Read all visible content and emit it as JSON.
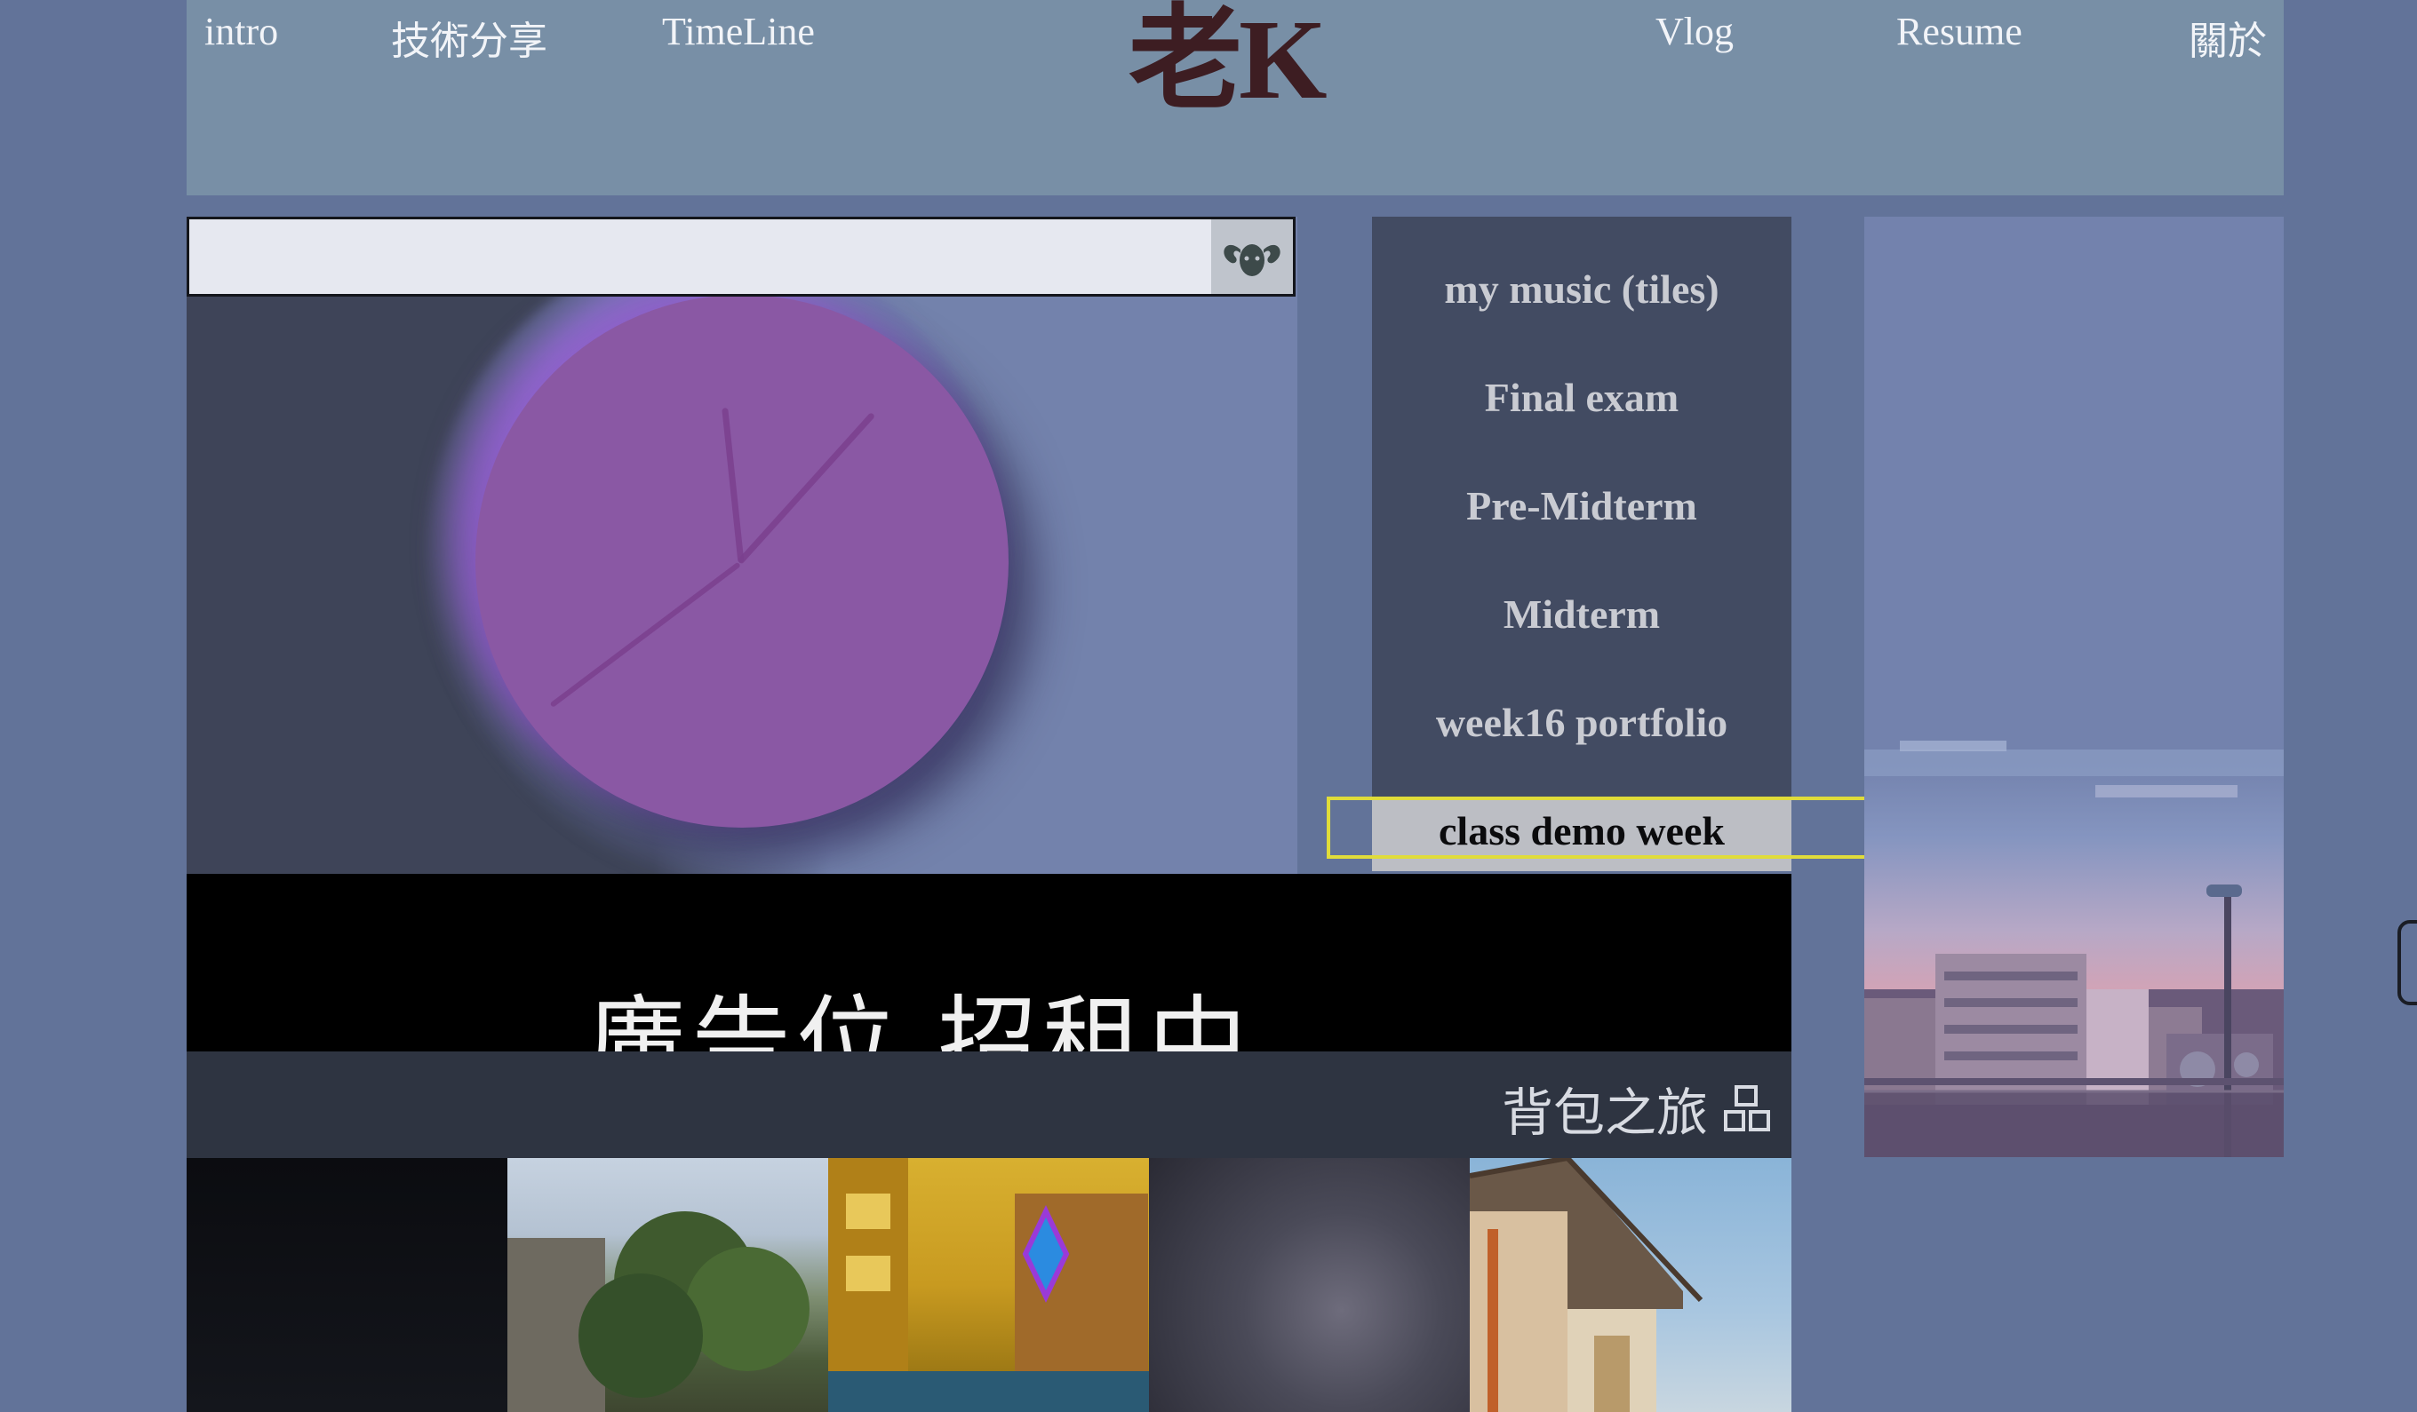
{
  "header": {
    "logo": "老K",
    "nav": [
      {
        "label": "intro"
      },
      {
        "label": "技術分享"
      },
      {
        "label": "TimeLine"
      },
      {
        "label": "Vlog"
      },
      {
        "label": "Resume"
      },
      {
        "label": "關於"
      }
    ]
  },
  "search": {
    "placeholder": "",
    "icon": "ram-icon"
  },
  "menu": {
    "items": [
      {
        "label": "my music (tiles)"
      },
      {
        "label": "Final exam"
      },
      {
        "label": "Pre-Midterm"
      },
      {
        "label": "Midterm"
      },
      {
        "label": "week16 portfolio"
      },
      {
        "label": "class demo week"
      }
    ],
    "active_index": 5
  },
  "ad": {
    "text": "廣告位 招租中"
  },
  "backpack": {
    "title": "背包之旅",
    "icon": "grid-icon"
  },
  "colors": {
    "page_bg": "#627399",
    "header_bg": "#788fa6",
    "logo": "#3d1d22",
    "menu_bg": "#424b62",
    "menu_active_bg": "#bcbec4",
    "focus_outline": "#e0dc3a",
    "clock_face": "#8a58a4",
    "ad_bg": "#000000"
  }
}
